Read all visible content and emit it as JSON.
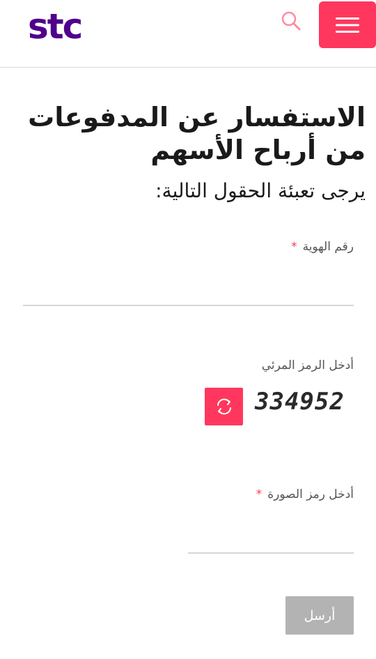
{
  "header": {
    "logo_text": "stc",
    "brand_color": "#4f008c",
    "accent_color": "#ff375e",
    "search_icon": "search-icon",
    "menu_icon": "hamburger-menu-icon"
  },
  "page": {
    "title": "الاستفسار عن المدفوعات من أرباح الأسهم",
    "subtitle": "يرجى تعبئة الحقول التالية:"
  },
  "form": {
    "id_number": {
      "label": "رقم الهوية",
      "required_mark": "*",
      "value": ""
    },
    "captcha": {
      "label": "أدخل الرمز المرئي",
      "code": "334952",
      "refresh_icon": "refresh-icon"
    },
    "image_code": {
      "label": "أدخل رمز الصورة",
      "required_mark": "*",
      "value": ""
    },
    "submit_label": "أرسل"
  }
}
